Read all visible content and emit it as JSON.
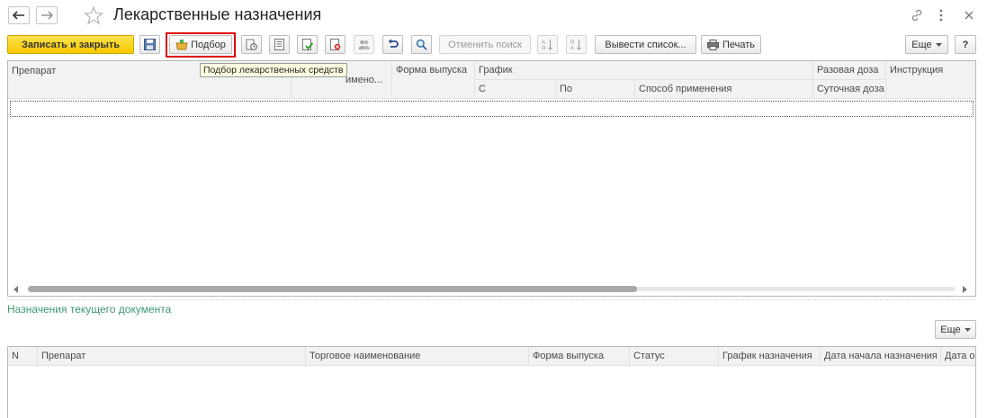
{
  "window": {
    "title": "Лекарственные назначения"
  },
  "toolbar": {
    "save_close_label": "Записать и закрыть",
    "selection_label": "Подбор",
    "cancel_search_label": "Отменить поиск",
    "output_list_label": "Вывести список...",
    "print_label": "Печать",
    "more_label": "Еще",
    "help_label": "?"
  },
  "tooltip": {
    "text": "Подбор лекарственных средств"
  },
  "top_table": {
    "columns": {
      "preparation": "Препарат",
      "trade_name_partial": "именo...",
      "release_form": "Форма выпуска",
      "schedule": "График",
      "from": "С",
      "to": "По",
      "method": "Способ применения",
      "single_dose": "Разовая доза",
      "daily_dose": "Суточная доза",
      "instruction": "Инструкция"
    }
  },
  "section": {
    "label": "Назначения текущего документа",
    "more_label": "Еще"
  },
  "bottom_table": {
    "columns": {
      "n": "N",
      "preparation": "Препарат",
      "trade_name": "Торговое наименование",
      "release_form": "Форма выпуска",
      "status": "Статус",
      "schedule": "График назначения",
      "start_date": "Дата начала назначения",
      "date_partial": "Дата о"
    }
  },
  "colors": {
    "accent_yellow": "#f5c800",
    "highlight_red": "#e00000",
    "section_green": "#3d9970"
  }
}
